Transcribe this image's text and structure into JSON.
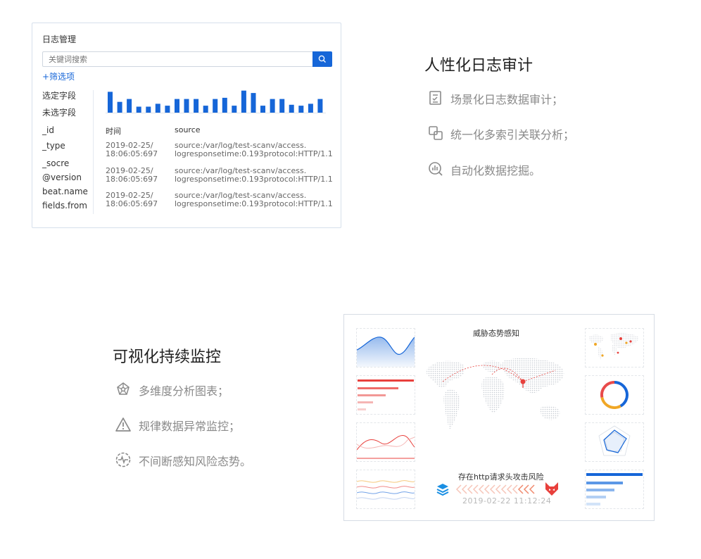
{
  "log_panel": {
    "title": "日志管理",
    "search_placeholder": "关键词搜索",
    "filter_link": "+筛选项",
    "selected_fields_label": "选定字段",
    "unselected_fields_label": "未选字段",
    "fields": [
      "_id",
      "_type",
      "_socre",
      "@version",
      "beat.name",
      "fields.from"
    ],
    "histogram": {
      "values": [
        0.9,
        0.48,
        0.6,
        0.28,
        0.28,
        0.4,
        0.32,
        0.6,
        0.6,
        0.6,
        0.32,
        0.6,
        0.65,
        0.32,
        0.95,
        0.85,
        0.32,
        0.6,
        0.6,
        0.36,
        0.32,
        0.4,
        0.6
      ],
      "color": "#1666d8"
    },
    "columns": [
      "时间",
      "source"
    ],
    "rows": [
      {
        "time_line1": "2019-02-25/",
        "time_line2": "18:06:05:697",
        "source_line1": "source:/var/log/test-scanv/access.",
        "source_line2": "logresponsetime:0.193protocol:HTTP/1.1"
      },
      {
        "time_line1": "2019-02-25/",
        "time_line2": "18:06:05:697",
        "source_line1": "source:/var/log/test-scanv/access.",
        "source_line2": "logresponsetime:0.193protocol:HTTP/1.1"
      },
      {
        "time_line1": "2019-02-25/",
        "time_line2": "18:06:05:697",
        "source_line1": "source:/var/log/test-scanv/access.",
        "source_line2": "logresponsetime:0.193protocol:HTTP/1.1"
      }
    ]
  },
  "feature_audit": {
    "title": "人性化日志审计",
    "items": [
      {
        "icon": "checklist-icon",
        "text": "场景化日志数据审计；"
      },
      {
        "icon": "link-icon",
        "text": "统一化多索引关联分析；"
      },
      {
        "icon": "data-search-icon",
        "text": "自动化数据挖掘。"
      }
    ]
  },
  "feature_monitor": {
    "title": "可视化持续监控",
    "items": [
      {
        "icon": "dimension-icon",
        "text": "多维度分析图表；"
      },
      {
        "icon": "warning-icon",
        "text": "规律数据异常监控；"
      },
      {
        "icon": "pulse-icon",
        "text": "不间断感知风险态势。"
      }
    ]
  },
  "dashboard": {
    "title": "威胁态势感知",
    "alert_text": "存在http请求头攻击风险",
    "alert_time": "2019-02-22 11:12:24",
    "donut": {
      "segments": [
        0.42,
        0.3,
        0.28
      ],
      "colors": [
        "#1666d8",
        "#f0a726",
        "#e84b4b"
      ]
    },
    "colors": {
      "blue": "#1666d8",
      "red": "#e8403c",
      "orange": "#f0a726"
    }
  }
}
